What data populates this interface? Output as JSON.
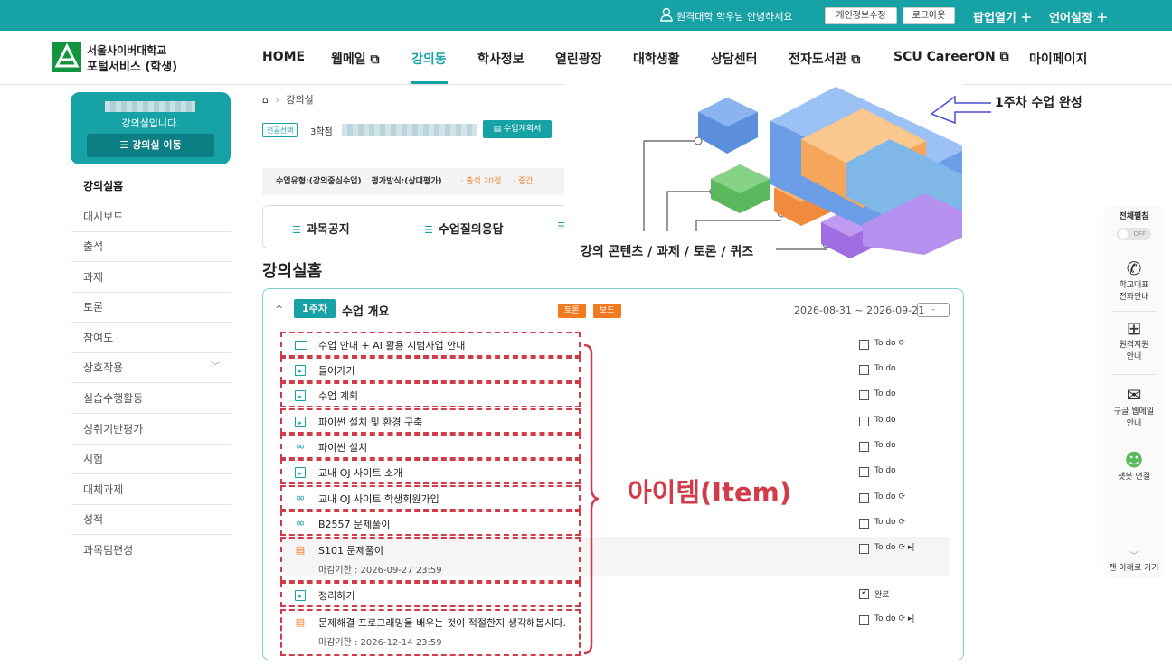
{
  "topbar": {
    "greeting": "원격대학 학우님 안녕하세요",
    "edit_profile": "개인정보수정",
    "logout": "로그아웃",
    "popup": "팝업열기 ＋",
    "language": "언어설정 ＋"
  },
  "logo": {
    "line1": "서울사이버대학교",
    "line2": "포털서비스 (학생)"
  },
  "nav": [
    {
      "label": "HOME"
    },
    {
      "label": "웹메일 ⧉"
    },
    {
      "label": "강의동"
    },
    {
      "label": "학사정보"
    },
    {
      "label": "열린광장"
    },
    {
      "label": "대학생활"
    },
    {
      "label": "상담센터"
    },
    {
      "label": "전자도서관 ⧉"
    },
    {
      "label": "SCU CareerON ⧉"
    },
    {
      "label": "마이페이지"
    }
  ],
  "sidebar": {
    "room_text": "강의실입니다.",
    "move_button": "☰ 강의실 이동",
    "items": [
      {
        "label": "강의실홈"
      },
      {
        "label": "대시보드"
      },
      {
        "label": "출석"
      },
      {
        "label": "과제"
      },
      {
        "label": "토론"
      },
      {
        "label": "참여도"
      },
      {
        "label": "상호작용"
      },
      {
        "label": "실습수행활동"
      },
      {
        "label": "성취기반평가"
      },
      {
        "label": "시험"
      },
      {
        "label": "대체과제"
      },
      {
        "label": "성적"
      },
      {
        "label": "과목팀편성"
      }
    ]
  },
  "breadcrumb": {
    "home_icon": "home-icon",
    "current": "강의실"
  },
  "course": {
    "tag": "전공선택",
    "credit": "3학점",
    "plan_button": "수업계획서",
    "type": "수업유형:(강의중심수업)",
    "eval": "평가방식:(상대평가)",
    "att": "· 출석 20점",
    "mid": "· 중간"
  },
  "tabs": [
    {
      "label": "과목공지"
    },
    {
      "label": "수업질의응답"
    }
  ],
  "section_title": "강의실홈",
  "week": {
    "badge": "1주차",
    "title": "수업 개요",
    "tag1": "토론",
    "tag2": "보드",
    "period": "2026-08-31 ~ 2026-09-21",
    "period_btn": "-"
  },
  "items": [
    {
      "icon": "folder-icon",
      "title": "수업 안내 + AI 활용 시범사업 안내",
      "status": "To do",
      "due": ""
    },
    {
      "icon": "page-icon",
      "title": "들어가기",
      "status": "To do",
      "due": ""
    },
    {
      "icon": "page-icon",
      "title": "수업 계획",
      "status": "To do",
      "due": ""
    },
    {
      "icon": "page-icon",
      "title": "파이썬 설치 및 환경 구축",
      "status": "To do",
      "due": ""
    },
    {
      "icon": "link-icon",
      "title": "파이썬 설치",
      "status": "To do",
      "due": ""
    },
    {
      "icon": "page-icon",
      "title": "교내 OJ 사이트 소개",
      "status": "To do",
      "due": ""
    },
    {
      "icon": "link-icon",
      "title": "교내 OJ 사이트 학생회원가입",
      "status": "To do",
      "due": ""
    },
    {
      "icon": "link-icon",
      "title": "B2557 문제풀이",
      "status": "To do",
      "due": ""
    },
    {
      "icon": "chat-icon",
      "title": "S101 문제풀이",
      "status": "To do",
      "due": "마감기한 : 2026-09-27 23:59"
    },
    {
      "icon": "page-icon",
      "title": "정리하기",
      "status": "완료",
      "due": ""
    },
    {
      "icon": "chat-icon",
      "title": "문제해결 프로그래밍을 배우는 것이 적절한지 생각해봅시다.",
      "status": "To do",
      "due": "마감기한 : 2026-12-14 23:59"
    }
  ],
  "annotation": {
    "item_label": "아이템(Item)",
    "week_done": "1주차 수업 완성",
    "contents": "강의 콘텐츠 / 과제 / 토론 / 퀴즈"
  },
  "right_panel": {
    "title": "전체펼침",
    "toggle": "OFF",
    "phone": "학교대표\n전화안내",
    "remote": "원격지원\n안내",
    "mail": "구글 웹메일\n안내",
    "chatbot": "챗봇 연결",
    "scroll_down": "맨 아래로 가기"
  },
  "colors": {
    "accent": "#17a2a6",
    "orange": "#f47a20",
    "annotation_red": "#d23b48",
    "logo_green": "#14943f"
  }
}
